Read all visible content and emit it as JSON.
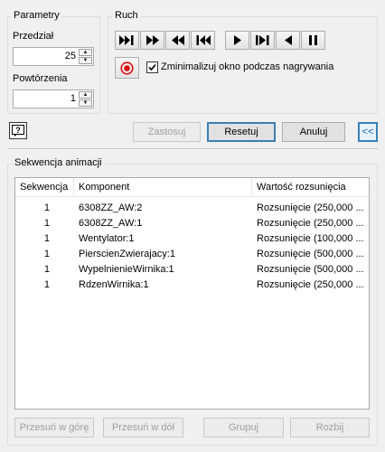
{
  "parametry": {
    "title": "Parametry",
    "przedzial_label": "Przedział",
    "przedzial_value": "25",
    "powtorzenia_label": "Powtórzenia",
    "powtorzenia_value": "1"
  },
  "ruch": {
    "title": "Ruch",
    "minimize_label": "Zminimalizuj okno podczas nagrywania",
    "minimize_checked": true
  },
  "buttons": {
    "apply": "Zastosuj",
    "reset": "Resetuj",
    "cancel": "Anuluj",
    "collapse": "<<"
  },
  "sequence": {
    "title": "Sekwencja animacji",
    "columns": [
      "Sekwencja",
      "Komponent",
      "Wartość rozsunięcia"
    ],
    "rows": [
      {
        "seq": "1",
        "component": "6308ZZ_AW:2",
        "value": "Rozsunięcie (250,000 ..."
      },
      {
        "seq": "1",
        "component": "6308ZZ_AW:1",
        "value": "Rozsunięcie (250,000 ..."
      },
      {
        "seq": "1",
        "component": "Wentylator:1",
        "value": "Rozsunięcie (100,000 ..."
      },
      {
        "seq": "1",
        "component": "PierscienZwierajacy:1",
        "value": "Rozsunięcie (500,000 ..."
      },
      {
        "seq": "1",
        "component": "WypelnienieWirnika:1",
        "value": "Rozsunięcie (500,000 ..."
      },
      {
        "seq": "1",
        "component": "RdzenWirnika:1",
        "value": "Rozsunięcie (250,000 ..."
      }
    ],
    "move_up": "Przesuń w górę",
    "move_down": "Przesuń w dół",
    "group": "Grupuj",
    "ungroup": "Rozbij"
  },
  "icons": {
    "help": "help-icon",
    "record": "record-icon",
    "play_to_end": "skip-to-end-icon",
    "play_forward": "fast-forward-icon",
    "play_backward": "rewind-icon",
    "play_to_start": "skip-to-start-icon",
    "step_forward": "play-icon",
    "step_forward_end": "step-forward-end-icon",
    "step_backward": "play-reverse-icon",
    "pause": "pause-icon"
  }
}
